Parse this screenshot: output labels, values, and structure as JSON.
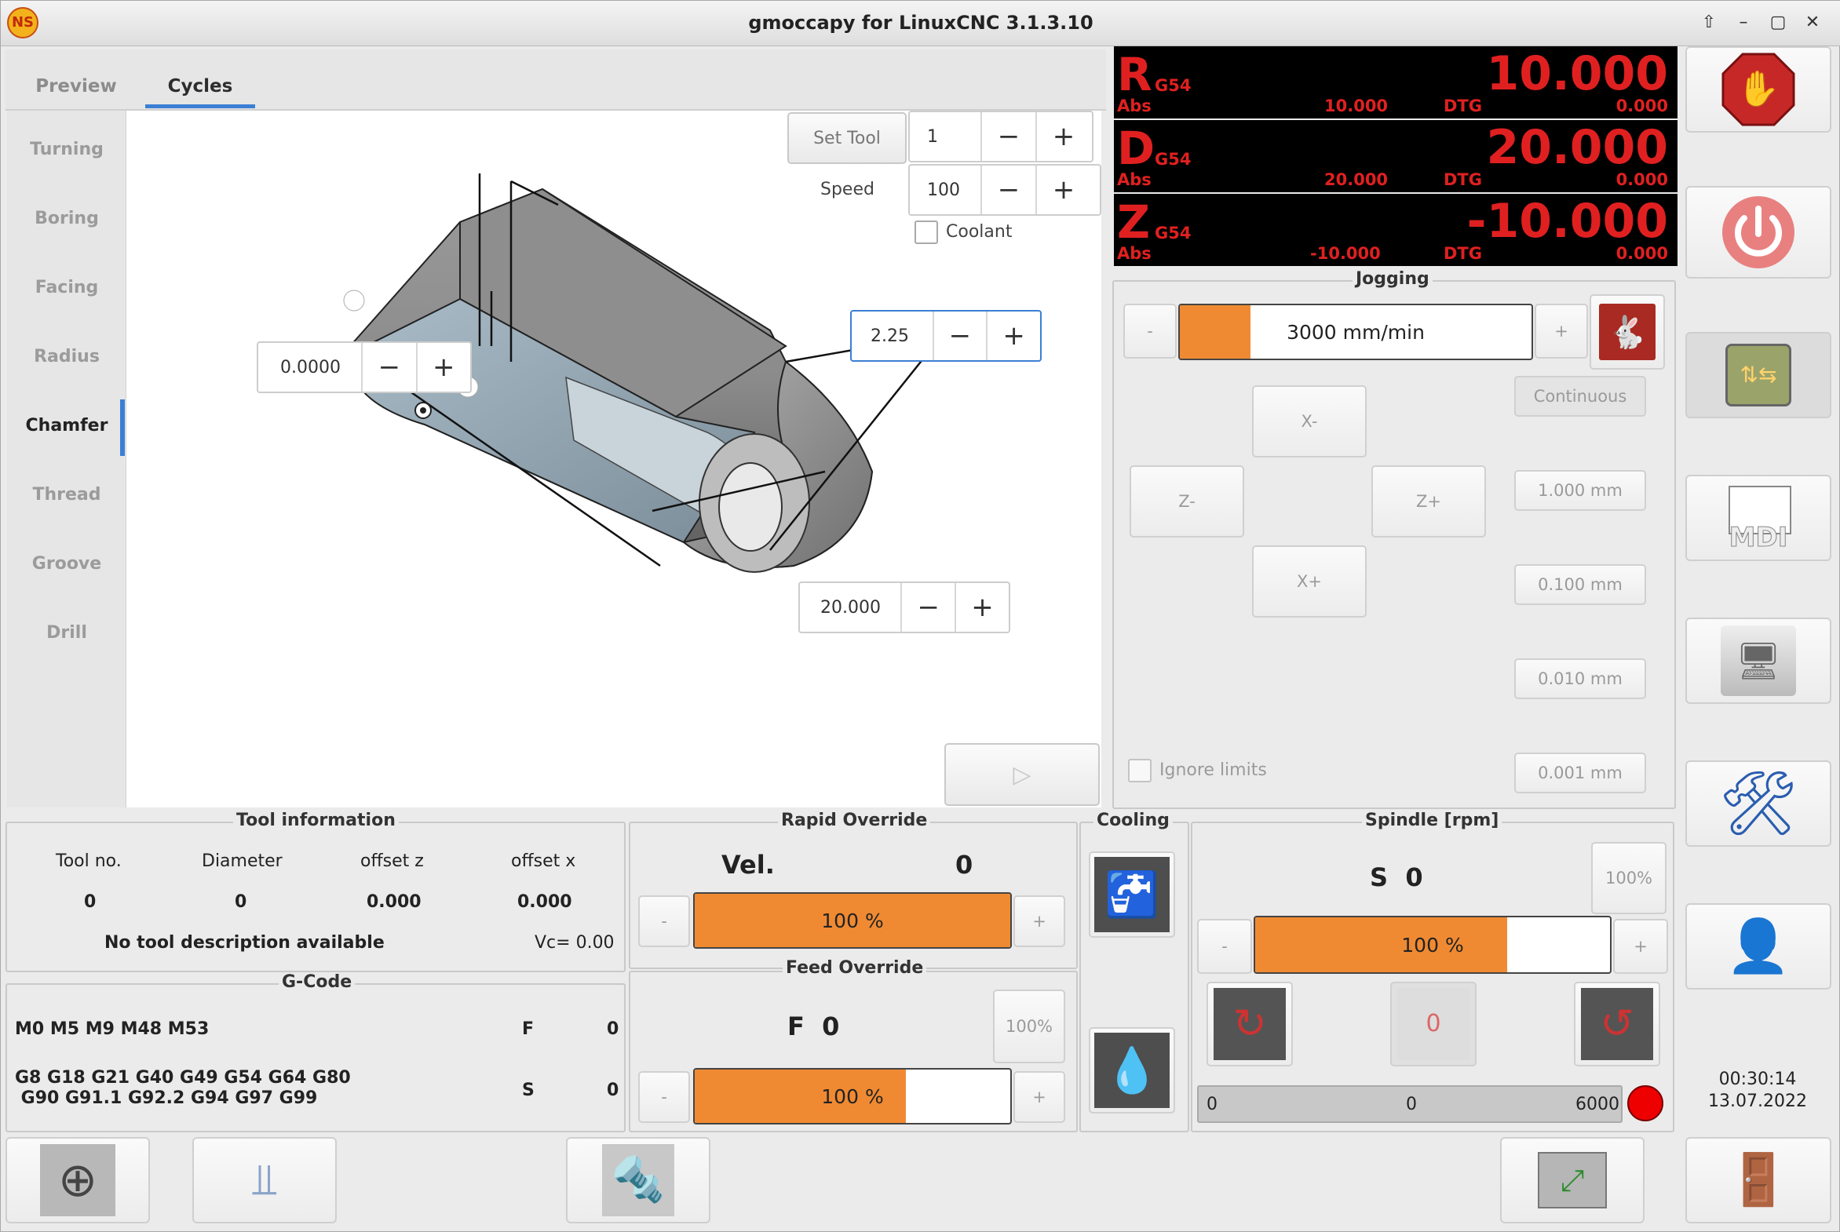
{
  "window": {
    "title": "gmoccapy for LinuxCNC  3.1.3.10",
    "logo_text": "NS"
  },
  "tabs": [
    {
      "label": "Preview"
    },
    {
      "label": "Cycles"
    }
  ],
  "cycles": [
    "Turning",
    "Boring",
    "Facing",
    "Radius",
    "Chamfer",
    "Thread",
    "Groove",
    "Drill"
  ],
  "cycle_panel": {
    "set_tool_label": "Set Tool",
    "tool_value": "1",
    "speed_label": "Speed",
    "speed_value": "100",
    "coolant_label": "Coolant",
    "chamfer_value": "2.25",
    "x_value": "0.0000",
    "z_value": "20.000",
    "run_icon": "▷"
  },
  "dro": [
    {
      "axis": "R",
      "coord": "G54",
      "value": "10.000",
      "abs_label": "Abs",
      "abs": "10.000",
      "dtg_label": "DTG",
      "dtg": "0.000"
    },
    {
      "axis": "D",
      "coord": "G54",
      "value": "20.000",
      "abs_label": "Abs",
      "abs": "20.000",
      "dtg_label": "DTG",
      "dtg": "0.000"
    },
    {
      "axis": "Z",
      "coord": "G54",
      "value": "-10.000",
      "abs_label": "Abs",
      "abs": "-10.000",
      "dtg_label": "DTG",
      "dtg": "0.000"
    }
  ],
  "jogging": {
    "title": "Jogging",
    "speed": "3000 mm/min",
    "speed_fraction": 0.2,
    "minus": "-",
    "plus": "+",
    "x_minus": "X-",
    "x_plus": "X+",
    "z_minus": "Z-",
    "z_plus": "Z+",
    "increments": [
      "Continuous",
      "1.000 mm",
      "0.100 mm",
      "0.010 mm",
      "0.001 mm"
    ],
    "ignore_limits": "Ignore limits"
  },
  "tool_info": {
    "title": "Tool information",
    "headers": [
      "Tool no.",
      "Diameter",
      "offset z",
      "offset x"
    ],
    "values": [
      "0",
      "0",
      "0.000",
      "0.000"
    ],
    "description": "No tool description available",
    "vc": "Vc= 0.00"
  },
  "gcode": {
    "title": "G-Code",
    "line1": "M0 M5 M9 M48 M53",
    "line2": "G8 G18 G21 G40 G49 G54 G64 G80",
    "line3": " G90 G91.1 G92.2 G94 G97 G99",
    "f_label": "F",
    "f_value": "0",
    "s_label": "S",
    "s_value": "0"
  },
  "rapid": {
    "title": "Rapid Override",
    "vel_label": "Vel.",
    "vel_value": "0",
    "value": "100 %",
    "fraction": 1.0,
    "minus": "-",
    "plus": "+"
  },
  "feed": {
    "title": "Feed Override",
    "label": "F  0",
    "reset": "100%",
    "value": "100 %",
    "fraction": 0.67,
    "minus": "-",
    "plus": "+"
  },
  "cooling": {
    "title": "Cooling"
  },
  "spindle": {
    "title": "Spindle [rpm]",
    "label": "S  0",
    "reset": "100%",
    "value": "100 %",
    "fraction": 0.71,
    "minus": "-",
    "plus": "+",
    "scale_min": "0",
    "scale_mid": "0",
    "scale_max": "6000",
    "stop_glyph": "0"
  },
  "status": {
    "time": "00:30:14",
    "date": "13.07.2022"
  },
  "right_buttons": {
    "mdi_label": "MDI"
  },
  "colors": {
    "accent": "#f08a32",
    "dro_text": "#e02020",
    "tab_active": "#3b7fd4"
  }
}
